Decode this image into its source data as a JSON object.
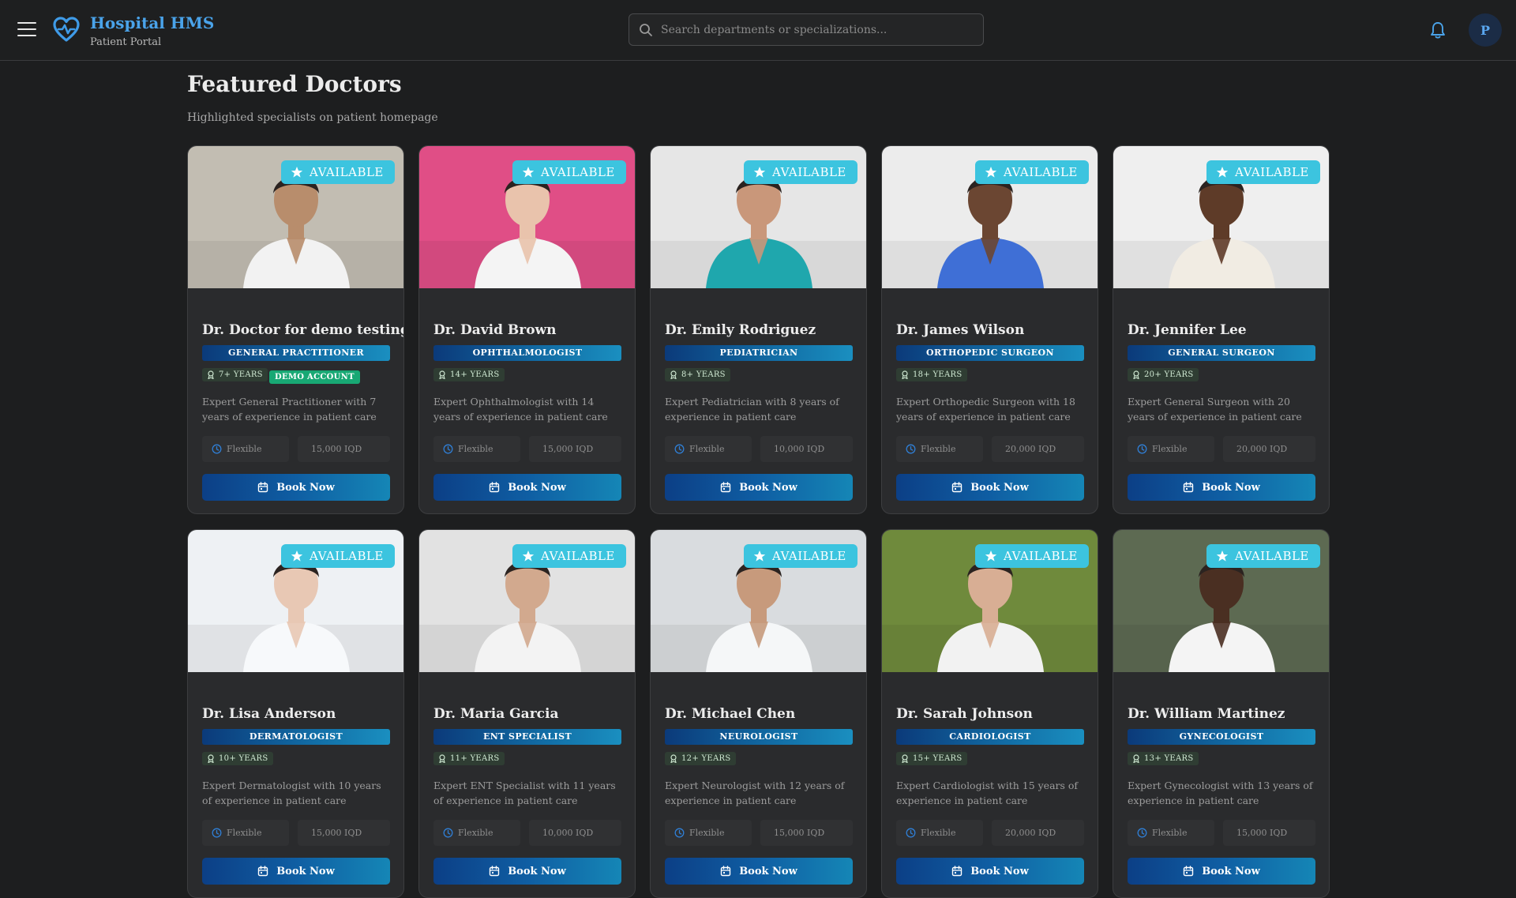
{
  "header": {
    "brand_title": "Hospital HMS",
    "brand_subtitle": "Patient Portal",
    "search_placeholder": "Search departments or specializations...",
    "avatar_initial": "P",
    "brand_color": "#4aa3ea"
  },
  "page": {
    "title": "Featured Doctors",
    "subtitle": "Highlighted specialists on patient homepage"
  },
  "labels": {
    "available": "AVAILABLE",
    "book_now": "Book Now",
    "schedule": "Flexible"
  },
  "doctors": [
    {
      "name": "Dr. Doctor for demo testing",
      "specialty": "GENERAL PRACTITIONER",
      "years": "7+ YEARS",
      "badge": "DEMO ACCOUNT",
      "desc": "Expert General Practitioner with 7 years of experience in patient care",
      "fee": "15,000 IQD",
      "bg": "#c2bdb2",
      "skin": "#b88d6c",
      "coat": "#f2f2f2"
    },
    {
      "name": "Dr. David Brown",
      "specialty": "OPHTHALMOLOGIST",
      "years": "14+ YEARS",
      "badge": "",
      "desc": "Expert Ophthalmologist with 14 years of experience in patient care",
      "fee": "15,000 IQD",
      "bg": "#e04e86",
      "skin": "#e9c3ac",
      "coat": "#f4f4f4"
    },
    {
      "name": "Dr. Emily Rodriguez",
      "specialty": "PEDIATRICIAN",
      "years": "8+ YEARS",
      "badge": "",
      "desc": "Expert Pediatrician with 8 years of experience in patient care",
      "fee": "10,000 IQD",
      "bg": "#e6e6e6",
      "skin": "#c9977a",
      "coat": "#1fa7ad"
    },
    {
      "name": "Dr. James Wilson",
      "specialty": "ORTHOPEDIC SURGEON",
      "years": "18+ YEARS",
      "badge": "",
      "desc": "Expert Orthopedic Surgeon with 18 years of experience in patient care",
      "fee": "20,000 IQD",
      "bg": "#ececec",
      "skin": "#6b4632",
      "coat": "#3f6fd6"
    },
    {
      "name": "Dr. Jennifer Lee",
      "specialty": "GENERAL SURGEON",
      "years": "20+ YEARS",
      "badge": "",
      "desc": "Expert General Surgeon with 20 years of experience in patient care",
      "fee": "20,000 IQD",
      "bg": "#efefef",
      "skin": "#5e3b28",
      "coat": "#f1ece3"
    },
    {
      "name": "Dr. Lisa Anderson",
      "specialty": "DERMATOLOGIST",
      "years": "10+ YEARS",
      "badge": "",
      "desc": "Expert Dermatologist with 10 years of experience in patient care",
      "fee": "15,000 IQD",
      "bg": "#eef1f4",
      "skin": "#e8c8b4",
      "coat": "#f7f9fb"
    },
    {
      "name": "Dr. Maria Garcia",
      "specialty": "ENT SPECIALIST",
      "years": "11+ YEARS",
      "badge": "",
      "desc": "Expert ENT Specialist with 11 years of experience in patient care",
      "fee": "10,000 IQD",
      "bg": "#e2e2e2",
      "skin": "#d2a98e",
      "coat": "#f3f3f3"
    },
    {
      "name": "Dr. Michael Chen",
      "specialty": "NEUROLOGIST",
      "years": "12+ YEARS",
      "badge": "",
      "desc": "Expert Neurologist with 12 years of experience in patient care",
      "fee": "15,000 IQD",
      "bg": "#d9dcdf",
      "skin": "#c79a7c",
      "coat": "#f5f7f8"
    },
    {
      "name": "Dr. Sarah Johnson",
      "specialty": "CARDIOLOGIST",
      "years": "15+ YEARS",
      "badge": "",
      "desc": "Expert Cardiologist with 15 years of experience in patient care",
      "fee": "20,000 IQD",
      "bg": "#6f8a3c",
      "skin": "#d8ae94",
      "coat": "#f2f2f2"
    },
    {
      "name": "Dr. William Martinez",
      "specialty": "GYNECOLOGIST",
      "years": "13+ YEARS",
      "badge": "",
      "desc": "Expert Gynecologist with 13 years of experience in patient care",
      "fee": "15,000 IQD",
      "bg": "#5d6a52",
      "skin": "#4a2f22",
      "coat": "#f4f4f4"
    }
  ]
}
